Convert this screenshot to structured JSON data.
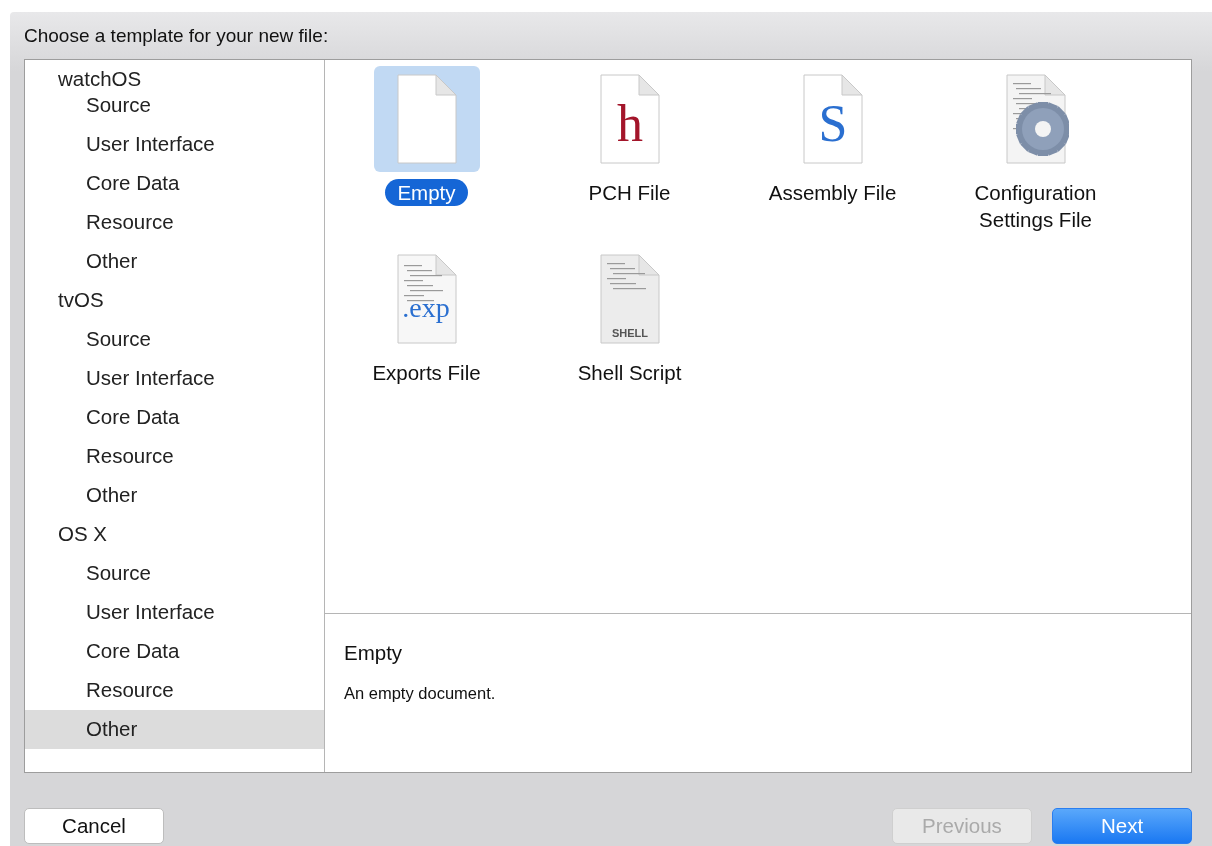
{
  "heading": "Choose a template for your new file:",
  "sidebar": [
    {
      "label": "watchOS",
      "children": [
        {
          "label": "Source",
          "selected": false
        },
        {
          "label": "User Interface",
          "selected": false
        },
        {
          "label": "Core Data",
          "selected": false
        },
        {
          "label": "Resource",
          "selected": false
        },
        {
          "label": "Other",
          "selected": false
        }
      ]
    },
    {
      "label": "tvOS",
      "children": [
        {
          "label": "Source",
          "selected": false
        },
        {
          "label": "User Interface",
          "selected": false
        },
        {
          "label": "Core Data",
          "selected": false
        },
        {
          "label": "Resource",
          "selected": false
        },
        {
          "label": "Other",
          "selected": false
        }
      ]
    },
    {
      "label": "OS X",
      "children": [
        {
          "label": "Source",
          "selected": false
        },
        {
          "label": "User Interface",
          "selected": false
        },
        {
          "label": "Core Data",
          "selected": false
        },
        {
          "label": "Resource",
          "selected": false
        },
        {
          "label": "Other",
          "selected": true
        }
      ]
    }
  ],
  "templates": [
    {
      "label": "Empty",
      "kind": "blank",
      "selected": true
    },
    {
      "label": "PCH File",
      "kind": "letter",
      "glyph": "h",
      "color": "#a3152a",
      "selected": false
    },
    {
      "label": "Assembly File",
      "kind": "letter",
      "glyph": "S",
      "color": "#2a6fd0",
      "selected": false
    },
    {
      "label": "Configuration Settings File",
      "kind": "gear",
      "selected": false
    },
    {
      "label": "Exports File",
      "kind": "exp",
      "glyph": ".exp",
      "selected": false
    },
    {
      "label": "Shell Script",
      "kind": "shell",
      "glyph": "SHELL",
      "selected": false
    }
  ],
  "description": {
    "title": "Empty",
    "text": "An empty document."
  },
  "buttons": [
    {
      "label": "Cancel",
      "kind": "plain",
      "disabled": false
    },
    {
      "label": "Previous",
      "kind": "plain",
      "disabled": true
    },
    {
      "label": "Next",
      "kind": "primary",
      "disabled": false
    }
  ]
}
